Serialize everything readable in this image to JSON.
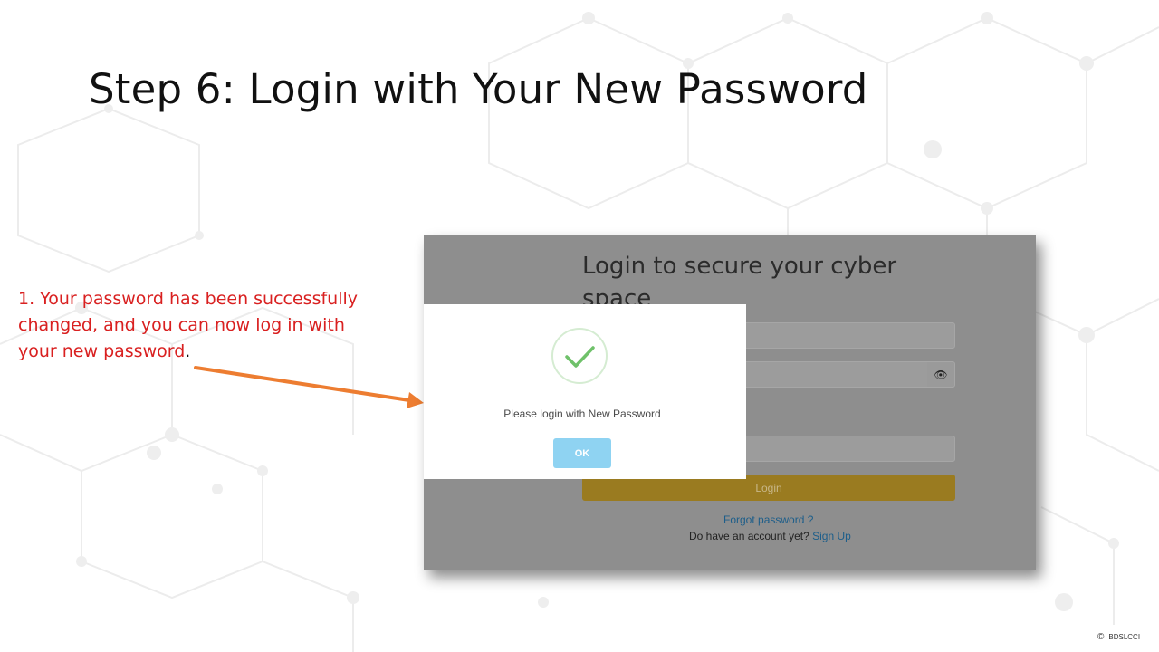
{
  "slide": {
    "title": "Step 6: Login with Your New Password",
    "callout_text": "1. Your password has been successfully changed, and you can now log in with your new password",
    "callout_period": ".",
    "callout_color": "#d92020",
    "arrow_color": "#ed7d31"
  },
  "login_page": {
    "heading": "Login to secure your cyber space",
    "eye_icon": "eye-icon",
    "login_button_label": "Login",
    "forgot_password_label": "Forgot password ?",
    "no_account_text": "Do have an account yet?",
    "sign_up_label": "Sign Up",
    "login_button_color": "#e8a21a",
    "link_color": "#1b90d8"
  },
  "modal": {
    "icon": "checkmark-icon",
    "message": "Please login with New Password",
    "ok_label": "OK",
    "ok_color": "#8fd3f2",
    "check_color": "#6fc16a"
  },
  "footer": {
    "copyright_symbol": "©",
    "owner": "BDSLCCI"
  }
}
